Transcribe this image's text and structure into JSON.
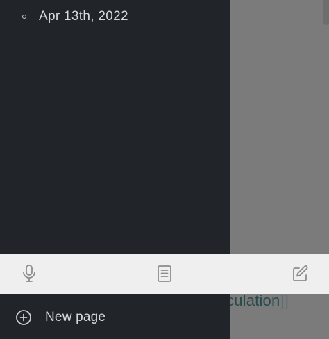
{
  "sidebar": {
    "journal_item": "Apr 13th, 2022",
    "new_page_label": "New page",
    "new_page_icon": "plus-circle-icon"
  },
  "background_page": {
    "link_text": "culation",
    "link_close_brackets": "]]"
  },
  "toolbar": {
    "buttons": [
      {
        "icon": "microphone-icon"
      },
      {
        "icon": "document-icon"
      },
      {
        "icon": "edit-icon"
      }
    ]
  },
  "colors": {
    "sidebar_bg": "#212529",
    "overlay_bg": "#7b7b7b",
    "toolbar_bg": "#efefef",
    "text_light": "#d7dadd",
    "icon_grey": "#8c8c8c",
    "link_color": "#274b4b"
  }
}
